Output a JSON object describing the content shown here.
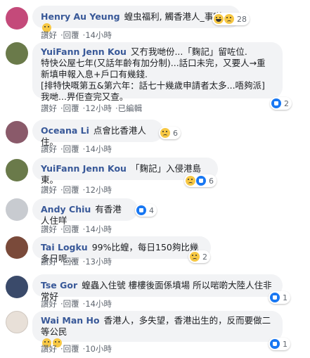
{
  "comments": [
    {
      "author": "Henry Au Yeung",
      "text": "蝗虫福利, 觸香港人_事咩.",
      "count": "28",
      "actions": [
        "讚好",
        "回覆",
        "14小時"
      ],
      "avatar_color": "#c44a7a"
    },
    {
      "author": "YuiFann Jenn Kou",
      "text": "又冇我哋份...「麴記」留咗位.\n特快公屋七年(又話年齡有加分制)...話口未完，又要人→重新填申報入息+戶口有幾錢.\n[排特快嘅第五&第六年：話七十幾歲申請者太多...唔夠派]\n我哋...畀佢查完又查。",
      "count": "2",
      "actions": [
        "讚好",
        "回覆",
        "12小時",
        "已編輯"
      ],
      "avatar_color": "#6a7a4a"
    },
    {
      "author": "Oceana Li",
      "text": "点會比香港人住。",
      "count": "6",
      "actions": [
        "讚好",
        "回覆",
        "14小時"
      ],
      "avatar_color": "#8a5a6a"
    },
    {
      "author": "YuiFann Jenn Kou",
      "text": "「麴記」入侵港島東。",
      "count": "6",
      "actions": [
        "讚好",
        "回覆",
        "12小時"
      ],
      "avatar_color": "#6a7a4a"
    },
    {
      "author": "Andy Chiu",
      "text": "有香港人住咩",
      "count": "4",
      "actions": [
        "讚好",
        "回覆",
        "14小時"
      ],
      "avatar_color": "#c8cbd0"
    },
    {
      "author": "Tai Logku",
      "text": "99%比蝗，每日150夠比幾多日呢...",
      "count": "2",
      "actions": [
        "讚好",
        "回覆",
        "13小時"
      ],
      "avatar_color": "#7a4a3a"
    },
    {
      "author": "Tse Gor",
      "text": "蝗蟲入住號 樓樓後面係墳場 所以啱啲大陸人住非常好",
      "count": "1",
      "actions": [
        "讚好",
        "回覆",
        "14小時"
      ],
      "avatar_color": "#3a4a6a"
    },
    {
      "author": "Wai Man Ho",
      "text": "香港人，多失望，香港出生的，反而要做二等公民",
      "count": "1",
      "actions": [
        "讚好",
        "回覆",
        "10小時"
      ],
      "avatar_color": "#e8e0d8"
    }
  ]
}
